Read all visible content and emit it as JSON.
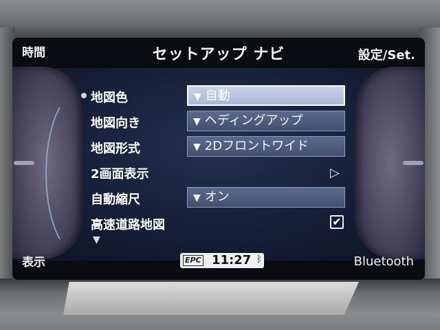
{
  "header": {
    "left_label": "時間",
    "title": "セットアップ ナビ",
    "right_label": "設定/Set."
  },
  "footer": {
    "left_label": "表示",
    "right_label": "Bluetooth",
    "epc_label": "EPC",
    "clock": "11:27",
    "bluetooth_icon": "bluetooth-icon"
  },
  "menu": {
    "items": [
      {
        "label": "地図色",
        "value": "自動",
        "control": "dropdown",
        "selected": true
      },
      {
        "label": "地図向き",
        "value": "ヘディングアップ",
        "control": "dropdown"
      },
      {
        "label": "地図形式",
        "value": "2Dフロントワイド",
        "control": "dropdown"
      },
      {
        "label": "2画面表示",
        "control": "submenu"
      },
      {
        "label": "自動縮尺",
        "value": "オン",
        "control": "dropdown"
      },
      {
        "label": "高速道路地図",
        "control": "checkbox",
        "checked": true
      }
    ],
    "dropdown_glyph": "▼",
    "submenu_glyph": "▷",
    "check_glyph": "✔",
    "more_glyph": "▼"
  },
  "colors": {
    "panel": "#1a2440",
    "selected_dropdown": "#b8c4e0",
    "dropdown": "#4f5c7e"
  }
}
